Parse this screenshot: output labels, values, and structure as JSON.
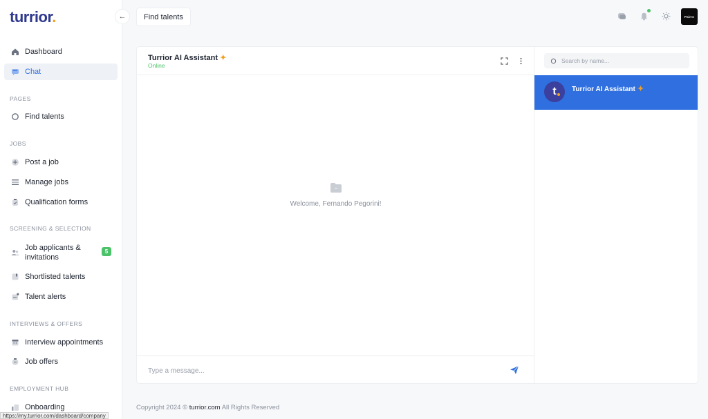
{
  "brand": {
    "logo_text": "turrior",
    "logo_dot": "."
  },
  "sidebar": {
    "collapse_glyph": "←",
    "primary": [
      {
        "label": "Dashboard",
        "icon": "home-icon"
      },
      {
        "label": "Chat",
        "icon": "chat-icon",
        "active": true
      }
    ],
    "sections": [
      {
        "title": "PAGES",
        "items": [
          {
            "label": "Find talents",
            "icon": "search-icon"
          }
        ]
      },
      {
        "title": "JOBS",
        "items": [
          {
            "label": "Post a job",
            "icon": "plus-circle-icon"
          },
          {
            "label": "Manage jobs",
            "icon": "list-icon"
          },
          {
            "label": "Qualification forms",
            "icon": "clipboard-icon"
          }
        ]
      },
      {
        "title": "SCREENING & SELECTION",
        "items": [
          {
            "label": "Job applicants & invitations",
            "icon": "users-icon",
            "badge": "5"
          },
          {
            "label": "Shortlisted talents",
            "icon": "bookmark-icon"
          },
          {
            "label": "Talent alerts",
            "icon": "bell-icon"
          }
        ]
      },
      {
        "title": "INTERVIEWS & OFFERS",
        "items": [
          {
            "label": "Interview appointments",
            "icon": "calendar-icon"
          },
          {
            "label": "Job offers",
            "icon": "offer-icon"
          }
        ]
      },
      {
        "title": "EMPLOYMENT HUB",
        "items": [
          {
            "label": "Onboarding",
            "icon": "onboarding-icon"
          }
        ]
      }
    ]
  },
  "topbar": {
    "tab_label": "Find talents",
    "avatar_text": "Pairro"
  },
  "chat": {
    "title": "Turrior AI Assistant",
    "spark": "✦",
    "status": "Online",
    "welcome": "Welcome, Fernando Pegorini!",
    "input_placeholder": "Type a message...",
    "search_placeholder": "Search by name...",
    "contacts": [
      {
        "name": "Turrior AI Assistant",
        "avatar_letter": "t"
      }
    ]
  },
  "footer": {
    "prefix": "Copyright 2024 ©",
    "site": "turrior.com",
    "suffix": "All Rights Reserved"
  },
  "browser_status_url": "https://my.turrior.com/dashboard/company",
  "colors": {
    "accent": "#2f6fe0",
    "brand": "#2f3a8f",
    "online": "#4cc36a",
    "spark": "#f0a020"
  }
}
